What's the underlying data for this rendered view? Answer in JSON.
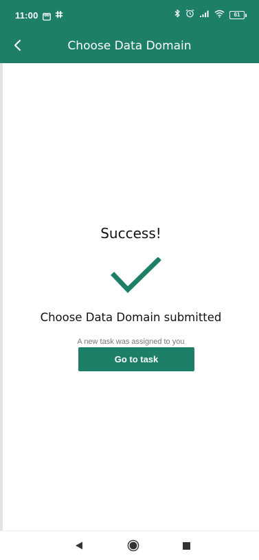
{
  "status_bar": {
    "time": "11:00",
    "calendar_day": "31",
    "battery_level": "61",
    "icons": [
      "calendar-icon",
      "slack-icon",
      "bluetooth-icon",
      "alarm-icon",
      "signal-icon",
      "wifi-icon",
      "battery-icon"
    ]
  },
  "app_bar": {
    "title": "Choose Data Domain",
    "back_icon": "chevron-left-icon"
  },
  "main": {
    "success_title": "Success!",
    "check_icon": "checkmark-icon",
    "submitted_text": "Choose Data Domain submitted",
    "assigned_text": "A new task was assigned to you",
    "go_button_label": "Go to task"
  },
  "nav_bar": {
    "icons": [
      "back-triangle-icon",
      "home-circle-icon",
      "recents-square-icon"
    ]
  },
  "colors": {
    "primary": "#1d7f68",
    "background": "#ffffff",
    "text": "#111111",
    "muted_text": "#777777"
  }
}
